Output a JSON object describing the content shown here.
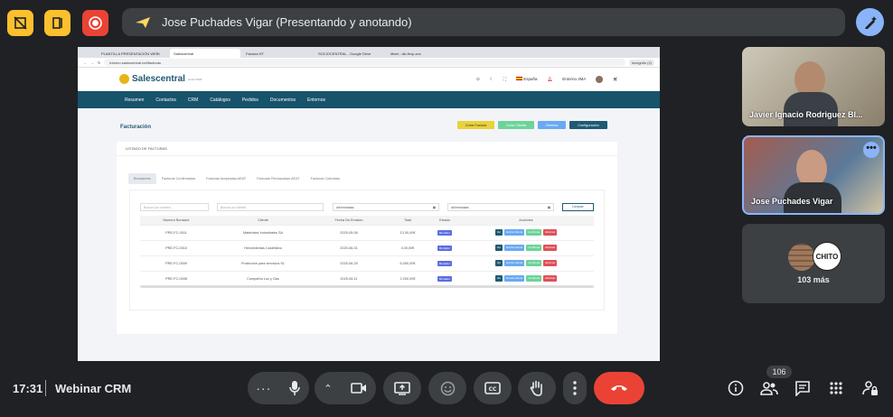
{
  "meet": {
    "presenter_banner": "Jose Puchades Vigar (Presentando y anotando)",
    "clock": "17:31",
    "meeting_name": "Webinar CRM",
    "participants_count": "106",
    "tiles": [
      {
        "name": "Javier Ignacio Rodriguez Bl..."
      },
      {
        "name": "Jose Puchades Vigar"
      },
      {
        "name": "103 más",
        "avatar_text": "CHITO"
      }
    ],
    "colors": {
      "yellow_btn": "#fbc02d",
      "red_btn": "#ea4335",
      "end_call": "#ea4335",
      "annotate": "#8ab4f8"
    },
    "icons": [
      "layout-off-icon",
      "door-icon",
      "record-icon",
      "send-icon",
      "annotate-icon",
      "more-icon",
      "mic-icon",
      "chevron-up-icon",
      "camera-icon",
      "present-icon",
      "emoji-icon",
      "captions-icon",
      "raise-hand-icon",
      "more-vert-icon",
      "end-call-icon",
      "info-icon",
      "people-icon",
      "chat-icon",
      "activities-icon",
      "lock-person-icon"
    ]
  },
  "browser": {
    "tabs": [
      "PLANTILLA PRESENTACIÓN WEBI",
      "Salescentral",
      "Factura HT",
      "SOCIOCENTRAL - Google Drive",
      "Meet - dlc-fnvp-zxc"
    ],
    "url": "interno.salescentral.net/facturas",
    "profile": "Incógnito (2)"
  },
  "app": {
    "logo": "Salescentral",
    "logo_sub": "smart CRM",
    "language": "España",
    "user": "Entorno JMA",
    "nav": [
      "Resumen",
      "Contactos",
      "CRM",
      "Catálogos",
      "Pedidos",
      "Documentos",
      "Entornos"
    ],
    "page_title": "Facturación",
    "top_buttons": [
      {
        "label": "Crear Factura",
        "color": "#e9d23a"
      },
      {
        "label": "Crear Cliente",
        "color": "#6cd49a"
      },
      {
        "label": "Clientes",
        "color": "#6aa9f2"
      },
      {
        "label": "Configuración",
        "color": "#1f5a72"
      }
    ],
    "section_title": "LISTADO DE FACTURAS",
    "subtabs": [
      "Borradores",
      "Facturas Confirmadas",
      "Facturas Aceptadas AEAT",
      "Facturas Rechazadas AEAT",
      "Facturas Cobradas"
    ],
    "filters": {
      "numero_placeholder": "Buscar por número",
      "cliente_placeholder": "Buscar por cliente",
      "date_from": "dd/mm/aaaa",
      "date_to": "dd/mm/aaaa",
      "clear": "Limpiar"
    },
    "columns": [
      "Número Borrador",
      "Cliente",
      "Fecha De Emisión",
      "Total",
      "Estado",
      "Acciones"
    ],
    "rows": [
      {
        "numero": "PRE-FC-0011",
        "cliente": "Materiales Industriales SA",
        "fecha": "2025-05-06",
        "total": "13.00,00€",
        "estado": "Borrador"
      },
      {
        "numero": "PRE-FC-0010",
        "cliente": "Herramientas Castellano",
        "fecha": "2025-06-01",
        "total": "3.00,00€",
        "estado": "Borrador"
      },
      {
        "numero": "PRE-FC-0009",
        "cliente": "Protección para servicios SL",
        "fecha": "2025-06-25",
        "total": "6.050,00€",
        "estado": "Borrador"
      },
      {
        "numero": "PRE-FC-0008",
        "cliente": "Compañía Luz y Gas",
        "fecha": "2025-06-11",
        "total": "2.200,00€",
        "estado": "Borrador"
      }
    ],
    "row_actions": [
      "Ver",
      "Enviar cliente",
      "Confirmar",
      "Eliminar"
    ]
  }
}
